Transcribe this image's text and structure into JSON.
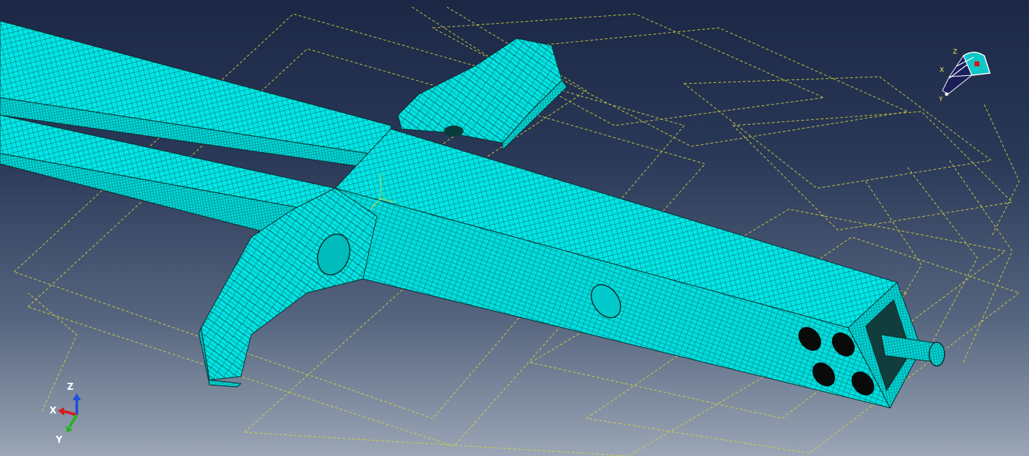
{
  "viewport": {
    "background_top": "#1b2745",
    "background_bottom": "#9ba6b6",
    "mesh_color": "#00e6e6",
    "mesh_line_color": "#0a2a2a",
    "datum_plane_color": "#d8d83a",
    "hole_color": "#0a0a0a"
  },
  "triad": {
    "x_label": "X",
    "y_label": "Y",
    "z_label": "Z",
    "x_color": "#d21e1e",
    "y_color": "#22b422",
    "z_color": "#2050e0"
  },
  "view_cube": {
    "x_label": "X",
    "y_label": "Y",
    "z_label": "Z",
    "marker_color": "#e01010"
  }
}
